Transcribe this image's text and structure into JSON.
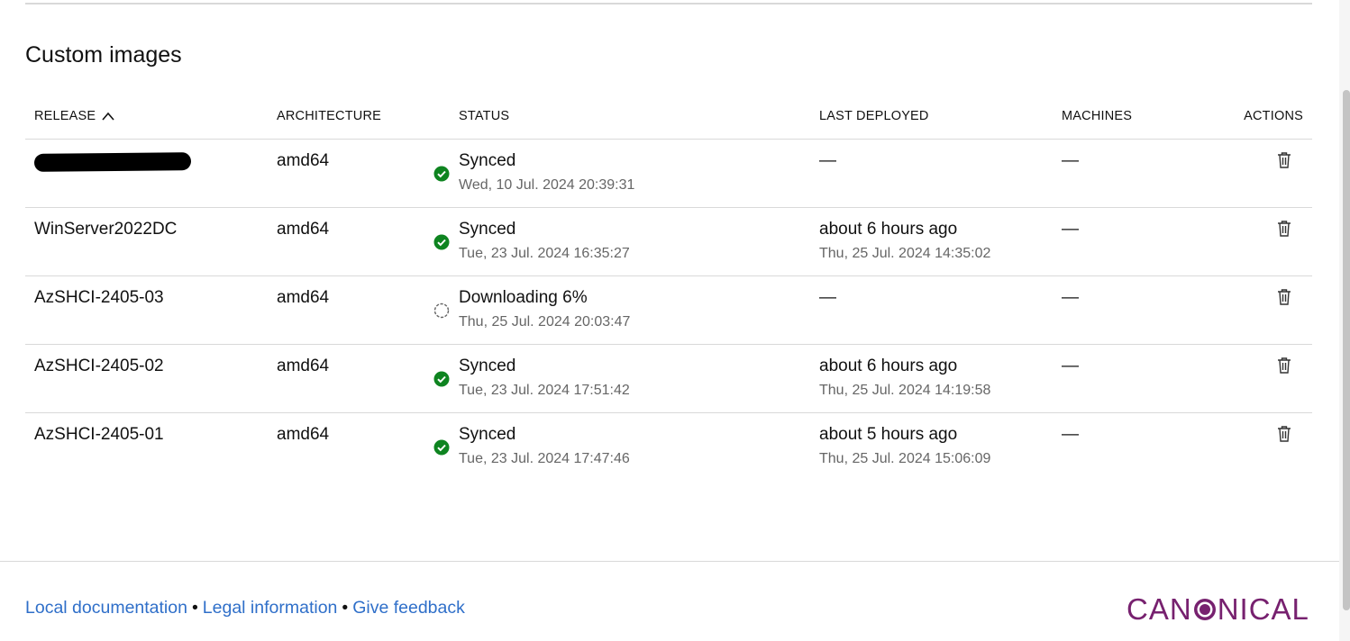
{
  "section_title": "Custom images",
  "table": {
    "headers": {
      "release": "RELEASE",
      "architecture": "ARCHITECTURE",
      "status": "STATUS",
      "last_deployed": "LAST DEPLOYED",
      "machines": "MACHINES",
      "actions": "ACTIONS"
    },
    "sort": {
      "column": "release",
      "direction": "ascending",
      "icon": "chevron-up-icon"
    },
    "rows": [
      {
        "release": "",
        "release_redacted": true,
        "architecture": "amd64",
        "status": "Synced",
        "status_icon": "success-check-icon",
        "status_time": "Wed, 10 Jul. 2024 20:39:31",
        "last_deployed": "—",
        "last_deployed_time": "",
        "machines": "—"
      },
      {
        "release": "WinServer2022DC",
        "release_redacted": false,
        "architecture": "amd64",
        "status": "Synced",
        "status_icon": "success-check-icon",
        "status_time": "Tue, 23 Jul. 2024 16:35:27",
        "last_deployed": "about 6 hours ago",
        "last_deployed_time": "Thu, 25 Jul. 2024 14:35:02",
        "machines": "—"
      },
      {
        "release": "AzSHCI-2405-03",
        "release_redacted": false,
        "architecture": "amd64",
        "status": "Downloading 6%",
        "status_icon": "spinner-icon",
        "status_time": "Thu, 25 Jul. 2024 20:03:47",
        "last_deployed": "—",
        "last_deployed_time": "",
        "machines": "—"
      },
      {
        "release": "AzSHCI-2405-02",
        "release_redacted": false,
        "architecture": "amd64",
        "status": "Synced",
        "status_icon": "success-check-icon",
        "status_time": "Tue, 23 Jul. 2024 17:51:42",
        "last_deployed": "about 6 hours ago",
        "last_deployed_time": "Thu, 25 Jul. 2024 14:19:58",
        "machines": "—"
      },
      {
        "release": "AzSHCI-2405-01",
        "release_redacted": false,
        "architecture": "amd64",
        "status": "Synced",
        "status_icon": "success-check-icon",
        "status_time": "Tue, 23 Jul. 2024 17:47:46",
        "last_deployed": "about 5 hours ago",
        "last_deployed_time": "Thu, 25 Jul. 2024 15:06:09",
        "machines": "—"
      }
    ]
  },
  "footer": {
    "links": [
      "Local documentation",
      "Legal information",
      "Give feedback"
    ],
    "separator": "•",
    "logo_text_left": "CAN",
    "logo_text_right": "NICAL"
  },
  "colors": {
    "success": "#0e8420",
    "link": "#2f6fc9",
    "brand": "#77216f",
    "muted_text": "#666666"
  }
}
